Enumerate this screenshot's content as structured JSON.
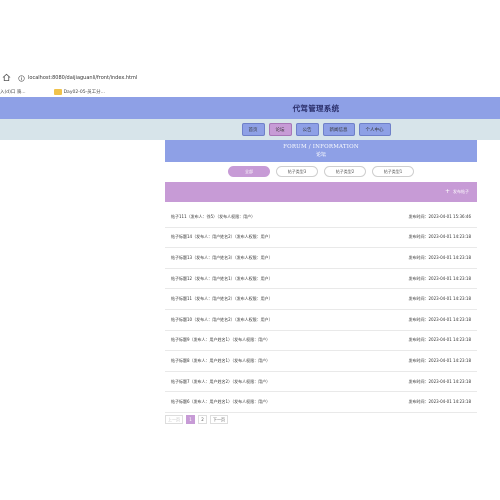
{
  "browser": {
    "url": "localhost:8080/daijiaguanli/front/index.html",
    "bookmarks": [
      "入(d)口 骑...",
      "Day02-05-员工分..."
    ]
  },
  "app": {
    "title": "代驾管理系统"
  },
  "nav": {
    "items": [
      "首页",
      "论坛",
      "公告",
      "新闻信息",
      "个人中心"
    ],
    "active_index": 1
  },
  "forum": {
    "title_en": "FORUM / INFORMATION",
    "title_cn": "论坛"
  },
  "categories": {
    "items": [
      "全部",
      "帖子类型3",
      "帖子类型2",
      "帖子类型1"
    ],
    "active_index": 0
  },
  "post_button": {
    "label": "发布帖子"
  },
  "posts": [
    {
      "title": "帖子111（发布人：徐5）（发布人权限：用户）",
      "time": "发布时间：2023-04-01 15:36:46"
    },
    {
      "title": "帖子标题14（发布人：用户姓名2）（发布人权限：用户）",
      "time": "发布时间：2023-04-01 14:23:18"
    },
    {
      "title": "帖子标题13（发布人：用户姓名3）（发布人权限：用户）",
      "time": "发布时间：2023-04-01 14:23:18"
    },
    {
      "title": "帖子标题12（发布人：用户姓名1）（发布人权限：用户）",
      "time": "发布时间：2023-04-01 14:23:18"
    },
    {
      "title": "帖子标题11（发布人：用户姓名2）（发布人权限：用户）",
      "time": "发布时间：2023-04-01 14:23:18"
    },
    {
      "title": "帖子标题10（发布人：用户姓名2）（发布人权限：用户）",
      "time": "发布时间：2023-04-01 14:23:18"
    },
    {
      "title": "帖子标题9（发布人：用户姓名1）（发布人权限：用户）",
      "time": "发布时间：2023-04-01 14:23:18"
    },
    {
      "title": "帖子标题8（发布人：用户姓名1）（发布人权限：用户）",
      "time": "发布时间：2023-04-01 14:23:18"
    },
    {
      "title": "帖子标题7（发布人：用户姓名2）（发布人权限：用户）",
      "time": "发布时间：2023-04-01 14:23:18"
    },
    {
      "title": "帖子标题6（发布人：用户姓名1）（发布人权限：用户）",
      "time": "发布时间：2023-04-01 14:23:18"
    }
  ],
  "pagination": {
    "prev_label": "上一页",
    "pages": [
      "1",
      "2"
    ],
    "active_page": "1",
    "next_label": "下一页"
  },
  "colors": {
    "header": "#8ea0e6",
    "accent": "#c79bd6",
    "navbar": "#d7e4ea"
  }
}
